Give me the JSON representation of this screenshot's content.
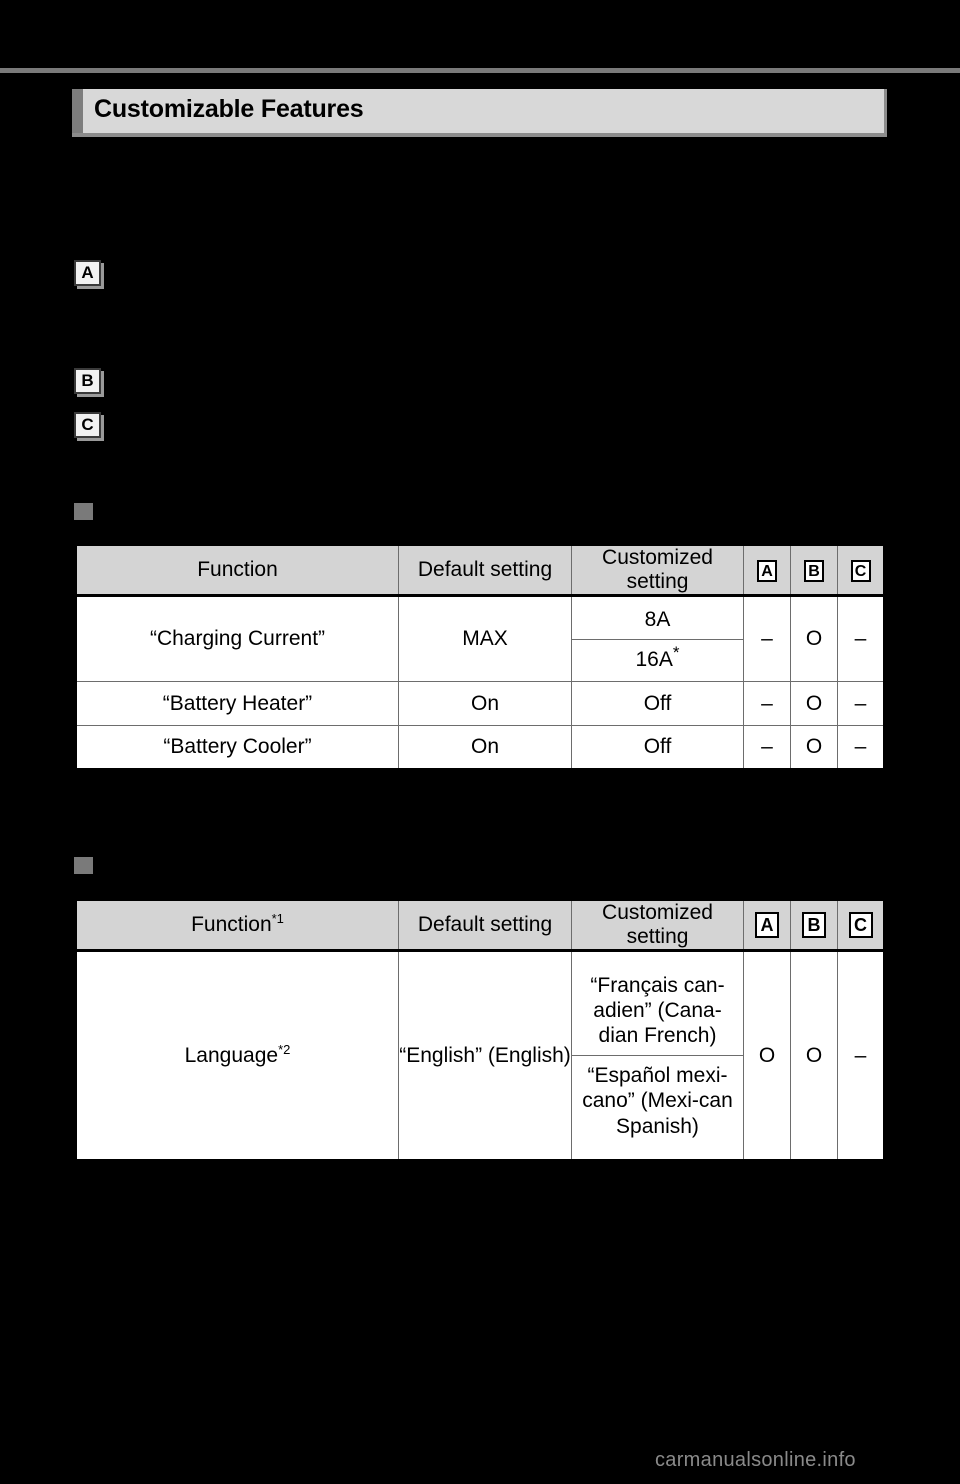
{
  "page": {
    "title": "Customizable Features",
    "watermark": "carmanualsonline.info"
  },
  "callouts": [
    {
      "label": "A"
    },
    {
      "label": "B"
    },
    {
      "label": "C"
    }
  ],
  "tables": [
    {
      "id": "table-1",
      "headers": {
        "function": "Function",
        "default": "Default setting",
        "customized": "Customized setting",
        "a": "A",
        "b": "B",
        "c": "C"
      },
      "rows": [
        {
          "function": "“Charging Current”",
          "default": "MAX",
          "customized": [
            "8A",
            "16A"
          ],
          "customized_superscripts": [
            "",
            "*"
          ],
          "a": "–",
          "b": "O",
          "c": "–"
        },
        {
          "function": "“Battery Heater”",
          "default": "On",
          "customized": [
            "Off"
          ],
          "customized_superscripts": [
            ""
          ],
          "a": "–",
          "b": "O",
          "c": "–"
        },
        {
          "function": "“Battery Cooler”",
          "default": "On",
          "customized": [
            "Off"
          ],
          "customized_superscripts": [
            ""
          ],
          "a": "–",
          "b": "O",
          "c": "–"
        }
      ]
    },
    {
      "id": "table-2",
      "headers": {
        "function": "Function",
        "function_superscript": "*1",
        "default": "Default setting",
        "customized": "Customized setting",
        "a": "A",
        "b": "B",
        "c": "C"
      },
      "rows": [
        {
          "function": "Language",
          "function_superscript": "*2",
          "default": "“English” (English)",
          "customized": [
            "“Français can-adien” (Cana-dian French)",
            "“Español mexi-cano” (Mexi-can Spanish)"
          ],
          "a": "O",
          "b": "O",
          "c": "–"
        }
      ]
    }
  ]
}
